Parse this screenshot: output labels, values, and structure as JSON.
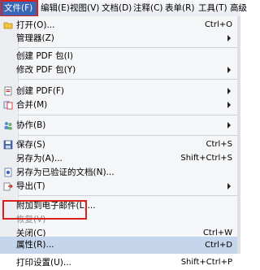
{
  "menubar": {
    "items": [
      {
        "label": "文件(F)",
        "active": true
      },
      {
        "label": "编辑(E)"
      },
      {
        "label": "视图(V)"
      },
      {
        "label": "文档(D)"
      },
      {
        "label": "注释(C)"
      },
      {
        "label": "表单(R)"
      },
      {
        "label": "工具(T)"
      },
      {
        "label": "高级"
      }
    ]
  },
  "menu": {
    "items": [
      {
        "id": "open",
        "label": "打开(O)...",
        "shortcut": "Ctrl+O",
        "icon": "open-folder-icon"
      },
      {
        "id": "organizer",
        "label": "管理器(Z)",
        "submenu": true
      },
      {
        "id": "create-pdf-package",
        "label": "创建 PDF 包(I)"
      },
      {
        "id": "modify-pdf-package",
        "label": "修改 PDF 包(Y)",
        "submenu": true
      },
      {
        "id": "create-pdf",
        "label": "创建 PDF(F)",
        "submenu": true,
        "icon": "create-pdf-icon"
      },
      {
        "id": "combine",
        "label": "合并(M)",
        "submenu": true,
        "icon": "combine-icon"
      },
      {
        "id": "collaborate",
        "label": "协作(B)",
        "submenu": true,
        "icon": "collaborate-icon"
      },
      {
        "id": "save",
        "label": "保存(S)",
        "shortcut": "Ctrl+S",
        "icon": "save-icon"
      },
      {
        "id": "save-as",
        "label": "另存为(A)...",
        "shortcut": "Shift+Ctrl+S"
      },
      {
        "id": "save-as-certified",
        "label": "另存为已验证的文档(N)...",
        "icon": "certified-doc-icon"
      },
      {
        "id": "export",
        "label": "导出(T)",
        "submenu": true,
        "icon": "export-icon"
      },
      {
        "id": "attach-email",
        "label": "附加到电子邮件(L)..."
      },
      {
        "id": "revert",
        "label": "恢复(V)",
        "disabled": true
      },
      {
        "id": "close",
        "label": "关闭(C)",
        "shortcut": "Ctrl+W"
      },
      {
        "id": "properties",
        "label": "属性(R)...",
        "shortcut": "Ctrl+D",
        "highlighted": true
      },
      {
        "id": "print-setup",
        "label": "打印设置(U)...",
        "shortcut": "Shift+Ctrl+P"
      }
    ]
  },
  "colors": {
    "highlight": "#c4d5ec",
    "active_menu": "#3b66b5",
    "annotation_box": "#d8211f"
  }
}
